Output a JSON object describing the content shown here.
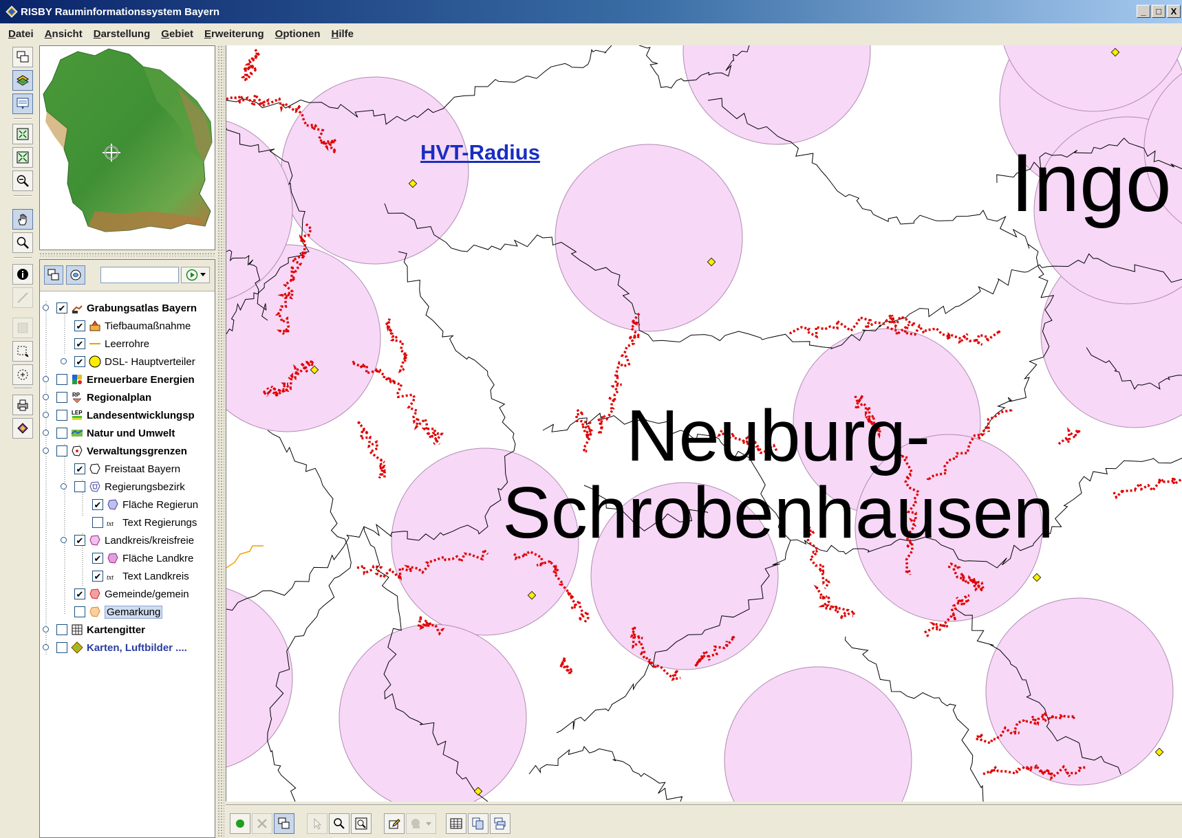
{
  "window": {
    "title": "RISBY Rauminformationssystem Bayern",
    "buttons": {
      "minimize": "_",
      "maximize": "□",
      "close": "X"
    }
  },
  "menu": [
    "Datei",
    "Ansicht",
    "Darstellung",
    "Gebiet",
    "Erweiterung",
    "Optionen",
    "Hilfe"
  ],
  "left_toolbar": [
    "overview-window-icon",
    "layers-icon",
    "legend-icon",
    "zoom-full-icon",
    "zoom-extent-icon",
    "zoom-out-icon",
    "pan-hand-icon",
    "zoom-in-icon",
    "info-icon",
    "measure-line-icon",
    "select-area-icon",
    "select-rectangle-icon",
    "select-circle-icon",
    "print-icon",
    "book-icon"
  ],
  "layer_panel": {
    "search_value": "",
    "search_placeholder": "",
    "items": [
      {
        "label": "Grabungsatlas Bayern",
        "bold": true,
        "checked": true,
        "level": 0,
        "icon": "excavator-icon"
      },
      {
        "label": "Tiefbaumaßnahme",
        "bold": false,
        "checked": true,
        "level": 1,
        "icon": "construction-icon"
      },
      {
        "label": "Leerrohre",
        "bold": false,
        "checked": true,
        "level": 1,
        "icon": "orange-line-icon"
      },
      {
        "label": "DSL- Hauptverteiler",
        "bold": false,
        "checked": true,
        "level": 1,
        "icon": "yellow-circle-icon"
      },
      {
        "label": "Erneuerbare Energien",
        "bold": true,
        "checked": false,
        "level": 0,
        "icon": "energy-icon"
      },
      {
        "label": "Regionalplan",
        "bold": true,
        "checked": false,
        "level": 0,
        "icon": "rp-icon"
      },
      {
        "label": "Landesentwicklungsp",
        "bold": true,
        "checked": false,
        "level": 0,
        "icon": "lep-icon"
      },
      {
        "label": "Natur und Umwelt",
        "bold": true,
        "checked": false,
        "level": 0,
        "icon": "nature-icon"
      },
      {
        "label": "Verwaltungsgrenzen",
        "bold": true,
        "checked": false,
        "level": 0,
        "icon": "boundary-icon"
      },
      {
        "label": "Freistaat Bayern",
        "bold": false,
        "checked": true,
        "level": 1,
        "icon": "state-outline-icon"
      },
      {
        "label": "Regierungsbezirk",
        "bold": false,
        "checked": false,
        "level": 1,
        "icon": "region-outline-icon"
      },
      {
        "label": "Fläche Regierun",
        "bold": false,
        "checked": true,
        "level": 2,
        "icon": "region-area-icon"
      },
      {
        "label": "Text Regierungs",
        "bold": false,
        "checked": false,
        "level": 2,
        "icon": "text-icon"
      },
      {
        "label": "Landkreis/kreisfreie",
        "bold": false,
        "checked": true,
        "level": 1,
        "icon": "district-outline-icon"
      },
      {
        "label": "Fläche Landkre",
        "bold": false,
        "checked": true,
        "level": 2,
        "icon": "district-area-icon"
      },
      {
        "label": "Text Landkreis",
        "bold": false,
        "checked": true,
        "level": 2,
        "icon": "text-icon"
      },
      {
        "label": "Gemeinde/gemein",
        "bold": false,
        "checked": true,
        "level": 1,
        "icon": "municipality-icon"
      },
      {
        "label": "Gemarkung",
        "bold": false,
        "checked": false,
        "level": 1,
        "icon": "parcel-icon",
        "selected": true
      },
      {
        "label": "Kartengitter",
        "bold": true,
        "checked": false,
        "level": 0,
        "icon": "grid-icon"
      },
      {
        "label": "Karten, Luftbilder ....",
        "bold": true,
        "checked": false,
        "level": 0,
        "icon": "maps-icon",
        "blue": true
      }
    ]
  },
  "map": {
    "district_label_line1": "Neuburg-",
    "district_label_line2": "Schrobenhausen",
    "city_label": "Ingo",
    "layer_label": "HVT-Radius"
  },
  "bottom_toolbar": [
    "ok-green-icon",
    "cancel-x-icon",
    "window-icon",
    "pointer-icon",
    "zoom-in-icon",
    "zoom-box-icon",
    "edit-icon",
    "stamp-dropdown-icon",
    "table-icon",
    "copy-icon",
    "windows-icon"
  ],
  "colors": {
    "title_start": "#0a246a",
    "title_end": "#a6caf0",
    "radius_fill": "#f7d8f7",
    "radius_stroke": "#b08ab0",
    "trench_red": "#e00000",
    "hvt_label": "#1a2ec0"
  }
}
